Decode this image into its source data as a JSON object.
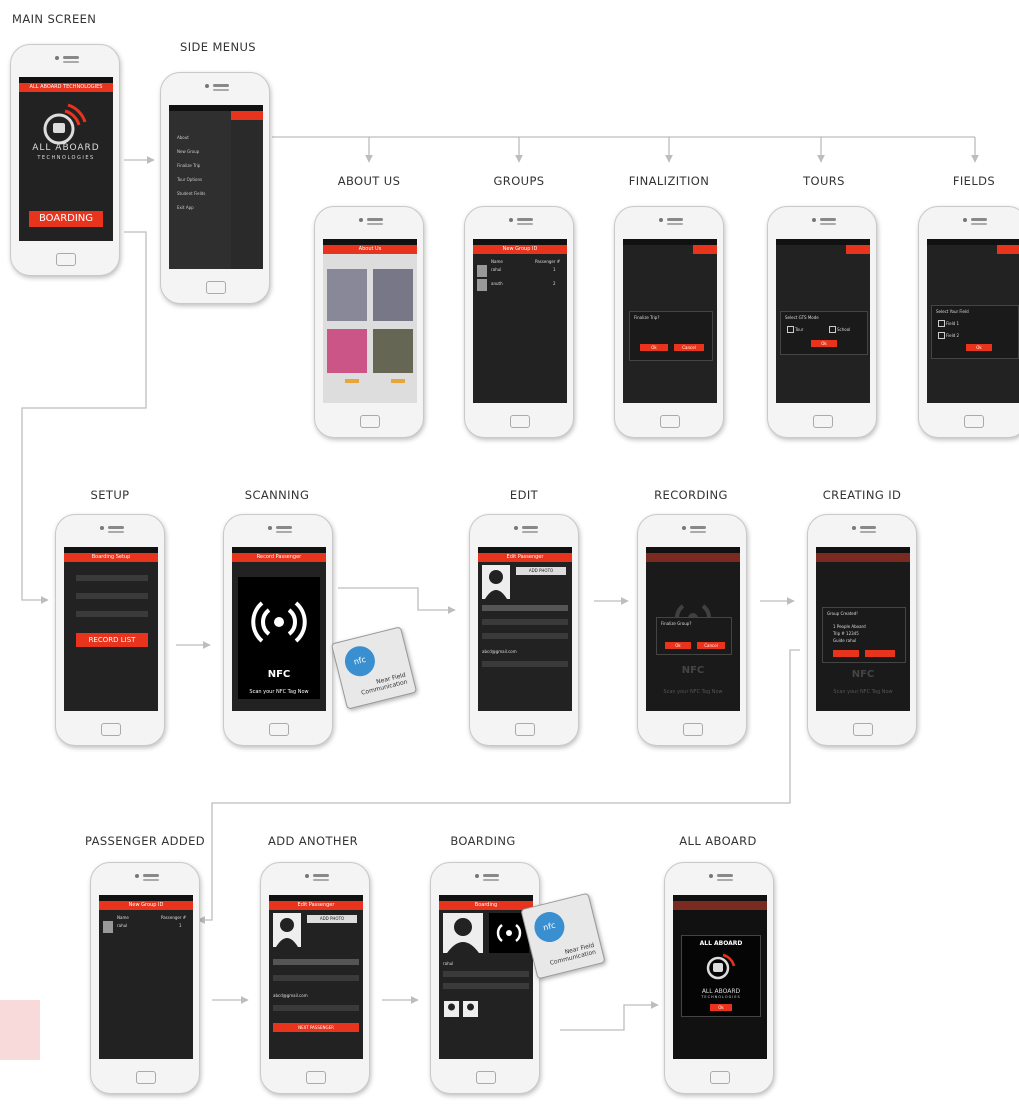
{
  "labels": {
    "main_screen": "MAIN SCREEN",
    "side_menus": "SIDE MENUS",
    "about_us": "ABOUT US",
    "groups": "GROUPS",
    "finalization": "FINALIZITION",
    "tours": "TOURS",
    "fields": "FIELDS",
    "setup": "SETUP",
    "scanning": "SCANNING",
    "edit": "EDIT",
    "recording": "RECORDING",
    "creating_id": "CREATING ID",
    "passenger_added": "PASSENGER ADDED",
    "add_another": "ADD ANOTHER",
    "boarding": "BOARDING",
    "all_aboard": "ALL ABOARD"
  },
  "screens": {
    "main": {
      "header": "ALL ABOARD TECHNOLOGIES",
      "logo_line1": "ALL ABOARD",
      "logo_line2": "TECHNOLOGIES",
      "button": "BOARDING"
    },
    "side_menu": {
      "items": [
        "About",
        "New Group",
        "Finalize Trip",
        "Tour Options",
        "Student Fields",
        "Exit App"
      ]
    },
    "about": {
      "header": "About Us"
    },
    "groups": {
      "header": "New Group ID",
      "col_name": "Name",
      "col_passenger": "Passenger #",
      "rows": [
        {
          "name": "rahul",
          "num": "1"
        },
        {
          "name": "anuth",
          "num": "2"
        }
      ]
    },
    "finalize": {
      "title": "Finalize Trip?",
      "ok": "Ok",
      "cancel": "Cancel"
    },
    "tours": {
      "title": "Select GTS Mode",
      "opt1": "Tour",
      "opt2": "School",
      "ok": "Ok"
    },
    "fields": {
      "title": "Select Your Field",
      "opt1": "Field 1",
      "opt2": "Field 2",
      "ok": "Ok"
    },
    "setup": {
      "header": "Boarding Setup",
      "button": "RECORD LIST"
    },
    "scanning": {
      "header": "Record Passenger",
      "nfc": "NFC",
      "prompt": "Scan your NFC Tag Now"
    },
    "edit": {
      "header": "Edit Passenger",
      "add_photo": "ADD PHOTO",
      "email": "abcd@gmail.com"
    },
    "recording": {
      "dialog": "Finalize Group?",
      "ok": "Ok",
      "cancel": "Cancel",
      "nfc": "NFC",
      "prompt": "Scan your NFC Tag Now"
    },
    "creating_id": {
      "title": "Group Created!",
      "line1": "1 People Aboard",
      "line2": "Trip # 12345",
      "line3": "Guide rahul",
      "nfc": "NFC",
      "prompt": "Scan your NFC Tag Now"
    },
    "passenger_added": {
      "header": "New Group ID",
      "col_name": "Name",
      "col_passenger": "Passenger #",
      "row_name": "rahul",
      "row_num": "1"
    },
    "add_another": {
      "header": "Edit Passenger",
      "add_photo": "ADD PHOTO",
      "email": "abcd@gmail.com",
      "button": "NEXT PASSENGER"
    },
    "boarding": {
      "header": "Boarding",
      "name": "rahul"
    },
    "all_aboard": {
      "title": "ALL ABOARD",
      "logo_line1": "ALL ABOARD",
      "logo_line2": "TECHNOLOGIES",
      "ok": "Ok"
    }
  },
  "nfc_card": {
    "line1": "Near Field",
    "line2": "Communication"
  },
  "colors": {
    "accent": "#e8341c",
    "screen_bg": "#222222",
    "connector": "#bdbdbd"
  }
}
